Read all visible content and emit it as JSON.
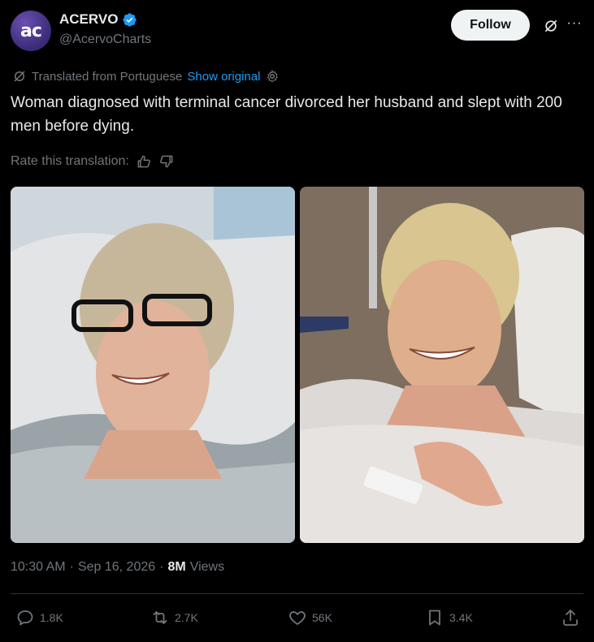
{
  "author": {
    "avatar_text": "ac",
    "name": "ACERVO",
    "handle": "@AcervoCharts"
  },
  "follow_label": "Follow",
  "more_label": "···",
  "translation": {
    "note": "Translated from Portuguese",
    "show_original": "Show original"
  },
  "tweet_text": "Woman diagnosed with terminal cancer divorced her husband and slept with 200 men before dying.",
  "rate_label": "Rate this translation:",
  "meta": {
    "time": "10:30 AM",
    "sep1": "·",
    "date": "Sep 16, 2026",
    "sep2": "·",
    "views_count": "8M",
    "views_label": "Views"
  },
  "actions": {
    "replies": "1.8K",
    "reposts": "2.7K",
    "likes": "56K",
    "bookmarks": "3.4K"
  },
  "colors": {
    "background": "#000000",
    "text": "#e7e9ea",
    "muted": "#71767b",
    "link": "#1d9bf0",
    "verified": "#1d9bf0"
  }
}
